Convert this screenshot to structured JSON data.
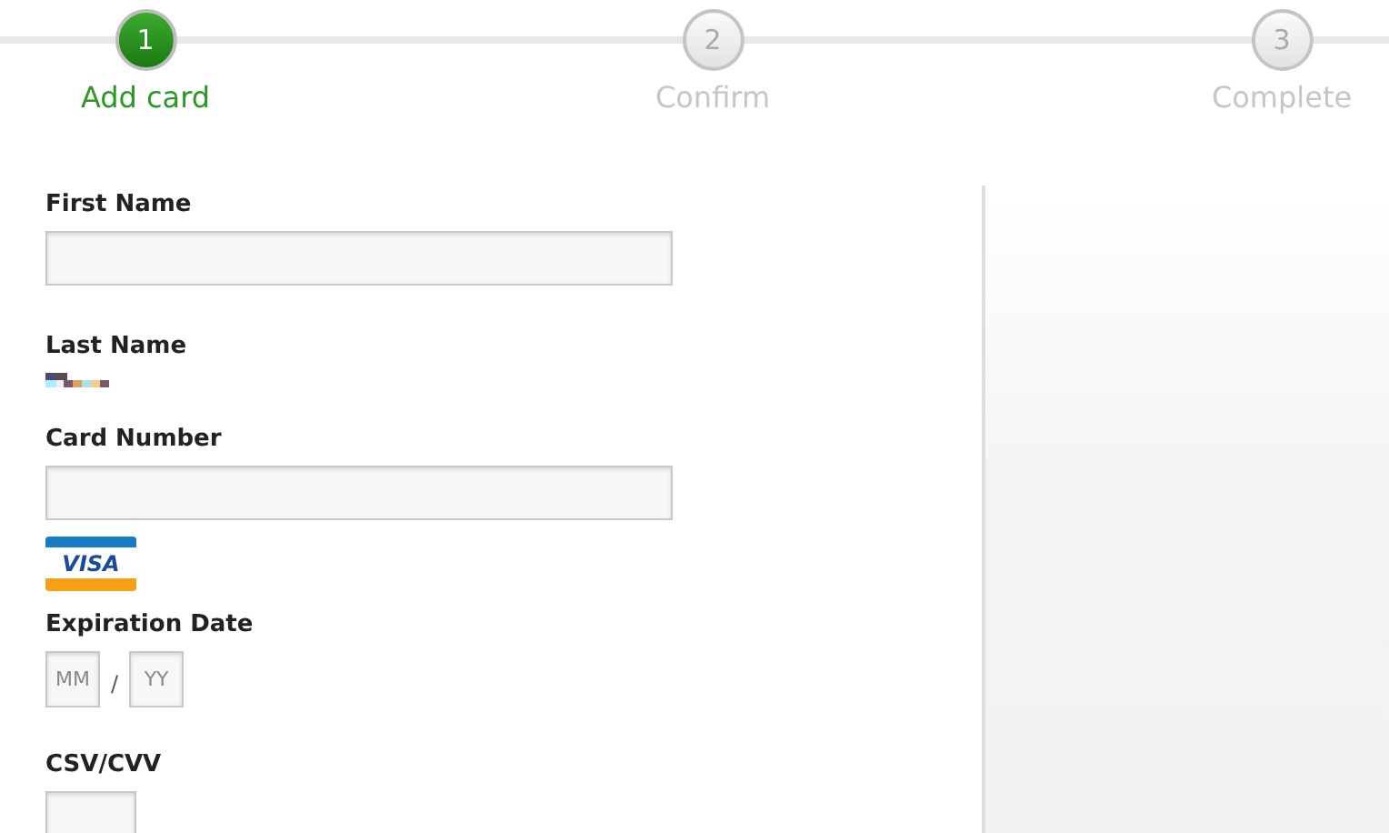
{
  "steps": [
    {
      "number": "1",
      "label": "Add card",
      "selected": true
    },
    {
      "number": "2",
      "label": "Confirm",
      "selected": false
    },
    {
      "number": "3",
      "label": "Complete",
      "selected": false
    }
  ],
  "form": {
    "first_name": {
      "label": "First Name"
    },
    "last_name": {
      "label": "Last Name"
    },
    "card_number": {
      "label": "Card Number"
    },
    "card_brand": "VISA",
    "expiration": {
      "label": "Expiration Date",
      "month_placeholder": "MM",
      "separator": "/",
      "year_placeholder": "YY"
    },
    "cvv": {
      "label": "CSV/CVV"
    }
  }
}
